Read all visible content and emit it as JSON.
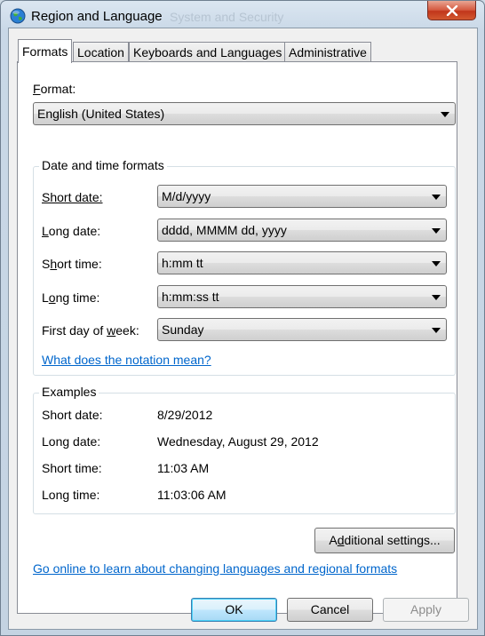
{
  "window": {
    "title": "Region and Language",
    "background_text": "System and Security"
  },
  "tabs": [
    {
      "label": "Formats",
      "active": true
    },
    {
      "label": "Location",
      "active": false
    },
    {
      "label": "Keyboards and Languages",
      "active": false
    },
    {
      "label": "Administrative",
      "active": false
    }
  ],
  "format": {
    "label_prefix": "",
    "label_underline": "F",
    "label_suffix": "ormat:",
    "value": "English (United States)"
  },
  "date_time_formats": {
    "group_title": "Date and time formats",
    "short_date": {
      "label_a": "Short date:",
      "value": "M/d/yyyy"
    },
    "long_date": {
      "label_u": "L",
      "label_b": "ong date:",
      "value": "dddd, MMMM dd, yyyy"
    },
    "short_time": {
      "label_a": "S",
      "label_u": "h",
      "label_b": "ort time:",
      "value": "h:mm tt"
    },
    "long_time": {
      "label_a": "L",
      "label_u": "o",
      "label_b": "ng time:",
      "value": "h:mm:ss tt"
    },
    "first_day": {
      "label_a": "First day of ",
      "label_u": "w",
      "label_b": "eek:",
      "value": "Sunday"
    },
    "notation_link": "What does the notation mean?"
  },
  "examples": {
    "group_title": "Examples",
    "rows": [
      {
        "label": "Short date:",
        "value": "8/29/2012"
      },
      {
        "label": "Long date:",
        "value": "Wednesday, August 29, 2012"
      },
      {
        "label": "Short time:",
        "value": "11:03 AM"
      },
      {
        "label": "Long time:",
        "value": "11:03:06 AM"
      }
    ]
  },
  "additional_settings": {
    "label_a": "A",
    "label_u": "d",
    "label_b": "ditional settings..."
  },
  "online_link": "Go online to learn about changing languages and regional formats",
  "buttons": {
    "ok": "OK",
    "cancel": "Cancel",
    "apply": "Apply"
  },
  "colors": {
    "link": "#0066cc",
    "close_button": "#c1361b"
  }
}
